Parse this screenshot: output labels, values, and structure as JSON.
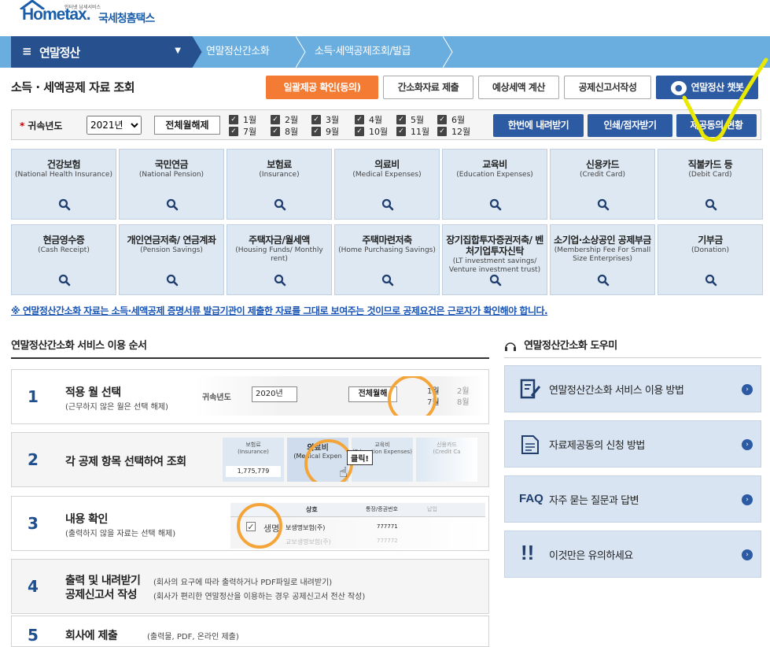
{
  "header": {
    "logo_tag": "인터넷 납세서비스",
    "logo_text": "Hometax.",
    "logo_kor": "국세청홈택스"
  },
  "nav": {
    "menu_icon": "≡",
    "main_menu": "연말정산",
    "breadcrumb": [
      "연말정산간소화",
      "소득·세액공제조회/발급"
    ]
  },
  "page": {
    "title": "소득 · 세액공제 자료 조회",
    "buttons": {
      "bulk_consent": "일괄제공 확인(동의)",
      "simplified_submit": "간소화자료 제출",
      "tax_estimate": "예상세액 계산",
      "deduction_report": "공제신고서작성",
      "chatbot": "연말정산 챗봇"
    }
  },
  "filter": {
    "year_label": "귀속년도",
    "year_value": "2021년",
    "select_all": "전체월해제",
    "months": [
      "1월",
      "2월",
      "3월",
      "4월",
      "5월",
      "6월",
      "7월",
      "8월",
      "9월",
      "10월",
      "11월",
      "12월"
    ],
    "download_all": "한번에 내려받기",
    "print_view": "인쇄/점자받기",
    "consent_status": "제공동의 현황"
  },
  "tiles": [
    {
      "ko": "건강보험",
      "en": "(National Health Insurance)"
    },
    {
      "ko": "국민연금",
      "en": "(National Pension)"
    },
    {
      "ko": "보험료",
      "en": "(Insurance)"
    },
    {
      "ko": "의료비",
      "en": "(Medical Expenses)"
    },
    {
      "ko": "교육비",
      "en": "(Education Expenses)"
    },
    {
      "ko": "신용카드",
      "en": "(Credit Card)"
    },
    {
      "ko": "직불카드 등",
      "en": "(Debit Card)"
    },
    {
      "ko": "현금영수증",
      "en": "(Cash Receipt)"
    },
    {
      "ko": "개인연금저축/ 연금계좌",
      "en": "(Pension Savings)"
    },
    {
      "ko": "주택자금/월세액",
      "en": "(Housing Funds/ Monthly rent)"
    },
    {
      "ko": "주택마련저축",
      "en": "(Home Purchasing Savings)"
    },
    {
      "ko": "장기집합투자증권저축/ 벤처기업투자신탁",
      "en": "(LT investment savings/ Venture investment trust)"
    },
    {
      "ko": "소기업·소상공인 공제부금",
      "en": "(Membership Fee For Small Size Enterprises)"
    },
    {
      "ko": "기부금",
      "en": "(Donation)"
    }
  ],
  "notice": "※ 연말정산간소화 자료는 소득·세액공제 증명서류 발급기관이 제출한 자료를 그대로 보여주는 것이므로 공제요건은 근로자가 확인해야 합니다.",
  "steps": {
    "title": "연말정산간소화 서비스 이용 순서",
    "items": [
      {
        "num": "1",
        "t1": "적용 월 선택",
        "t2": "(근무하지 않은 월은 선택 해제)"
      },
      {
        "num": "2",
        "t1": "각 공제 항목 선택하여 조회",
        "t2": ""
      },
      {
        "num": "3",
        "t1": "내용 확인",
        "t2": "(출력하지 않을 자료는 선택 해제)"
      },
      {
        "num": "4",
        "t1": "출력 및 내려받기",
        "t1b": "공제신고서 작성",
        "t2": "(회사의 요구에 따라 출력하거나 PDF파일로 내려받기)",
        "t2b": "(회사가 편리한 연말정산을 이용하는 경우 공제신고서 전산 작성)"
      },
      {
        "num": "5",
        "t1": "회사에 제출",
        "t2": "(출력물, PDF, 온라인 제출)"
      }
    ],
    "illu1": {
      "label": "귀속년도",
      "year": "2020년",
      "btn": "전체월해",
      "m1": "1월",
      "m2": "2월",
      "m7": "7월",
      "m8": "8월"
    },
    "illu2": {
      "t1": "보험료",
      "t1e": "(Insurance)",
      "val": "1,775,779",
      "t2": "의료비",
      "t2e": "(Medical Expen",
      "t3": "교육비",
      "t3e": "(Education Expenses)",
      "t4": "신용카드",
      "t4e": "(Credit Ca",
      "tip": "클릭!"
    },
    "illu3": {
      "h1": "상호",
      "h2": "통장/증권번호",
      "h3": "납입",
      "r1a": "생명",
      "r1b": "보생명보험(주)",
      "r1c": "777771",
      "r2b": "교보생명보험(주)",
      "r2c": "777772"
    }
  },
  "helper": {
    "title": "연말정산간소화 도우미",
    "items": [
      {
        "label": "연말정산간소화 서비스 이용 방법",
        "icon": "form-pen-icon"
      },
      {
        "label": "자료제공동의 신청 방법",
        "icon": "document-icon"
      },
      {
        "label": "자주 묻는 질문과 답변",
        "icon": "faq-icon",
        "prefix": "FAQ"
      },
      {
        "label": "이것만은 유의하세요",
        "icon": "exclamation-icon"
      }
    ]
  },
  "colors": {
    "nav_dark": "#27508f",
    "nav_light": "#6aaee0",
    "accent_orange": "#f47b33",
    "button_blue": "#2c5aa3",
    "tile_bg": "#dde8f3",
    "ring": "#f4a53a",
    "checkmark": "#e8e800"
  }
}
